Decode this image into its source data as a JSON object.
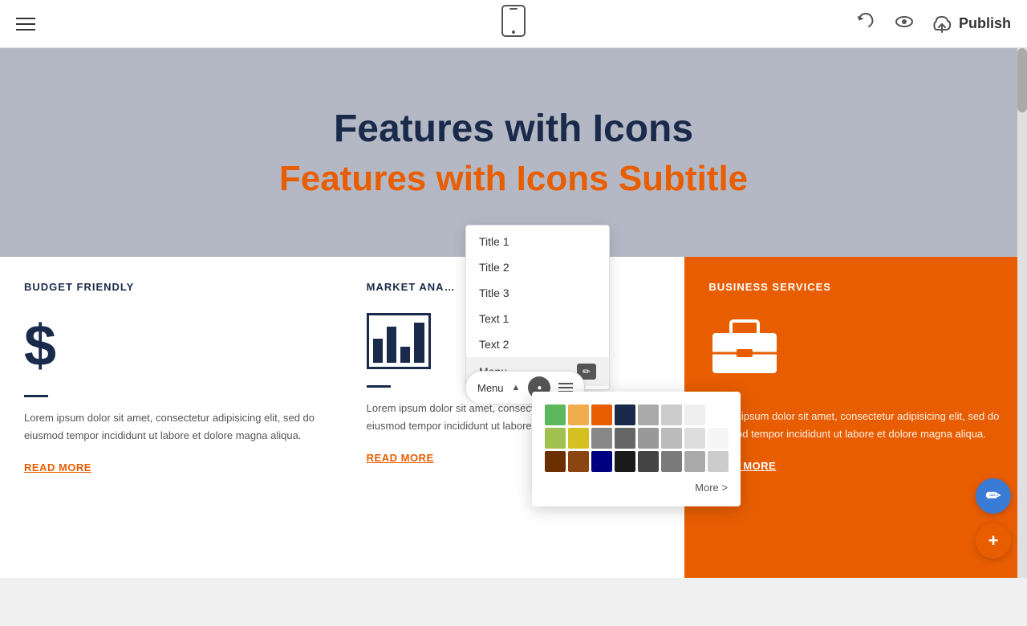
{
  "toolbar": {
    "hamburger_label": "menu",
    "phone_icon": "📱",
    "undo_label": "↺",
    "preview_label": "👁",
    "publish_label": "Publish",
    "publish_icon": "☁"
  },
  "hero": {
    "title": "Features with Icons",
    "subtitle": "Features with Icons Subtitle"
  },
  "features": [
    {
      "id": "budget",
      "title": "BUDGET FRIENDLY",
      "icon_type": "dollar",
      "text": "Lorem ipsum dolor sit amet, consectetur adipisicing elit, sed do eiusmod tempor incididunt ut labore et dolore magna aliqua.",
      "read_more": "READ MORE",
      "orange": false
    },
    {
      "id": "market",
      "title": "MARKET ANA…",
      "icon_type": "barchart",
      "text": "Lorem ipsum dolor sit amet, consectetur adipisicing elit, sed do eiusmod tempor incididunt ut labore et dolore m…",
      "read_more": "READ MORE",
      "orange": false
    },
    {
      "id": "business",
      "title": "BUSINESS SERVICES",
      "icon_type": "briefcase",
      "text": "Lorem ipsum dolor sit amet, consectetur adipisicing elit, sed do eiusmod tempor incididunt ut labore et dolore magna aliqua.",
      "read_more": "READ MORE",
      "orange": true
    }
  ],
  "dropdown": {
    "items": [
      {
        "label": "Title 1"
      },
      {
        "label": "Title 2"
      },
      {
        "label": "Title 3"
      },
      {
        "label": "Text 1"
      },
      {
        "label": "Text 2"
      },
      {
        "label": "Menu",
        "active": true,
        "has_edit": true
      }
    ]
  },
  "menu_toggle": {
    "label": "Menu",
    "chevron": "▲"
  },
  "color_picker": {
    "colors": [
      "#5cb85c",
      "#f0ad4e",
      "#e85d00",
      "#1a2a4a",
      "#aaaaaa",
      "#cccccc",
      "#eeeeee",
      "#ffffff",
      "#a0c050",
      "#d4c020",
      "#888888",
      "#666666",
      "#999999",
      "#bbbbbb",
      "#dddddd",
      "#f5f5f5",
      "#6a3000",
      "#8B4513",
      "#000080",
      "#1a1a1a",
      "#444444",
      "#7a7a7a",
      "#aaaaaa",
      "#cccccc"
    ],
    "more_label": "More >"
  },
  "fabs": {
    "edit_icon": "✏",
    "add_icon": "+"
  }
}
